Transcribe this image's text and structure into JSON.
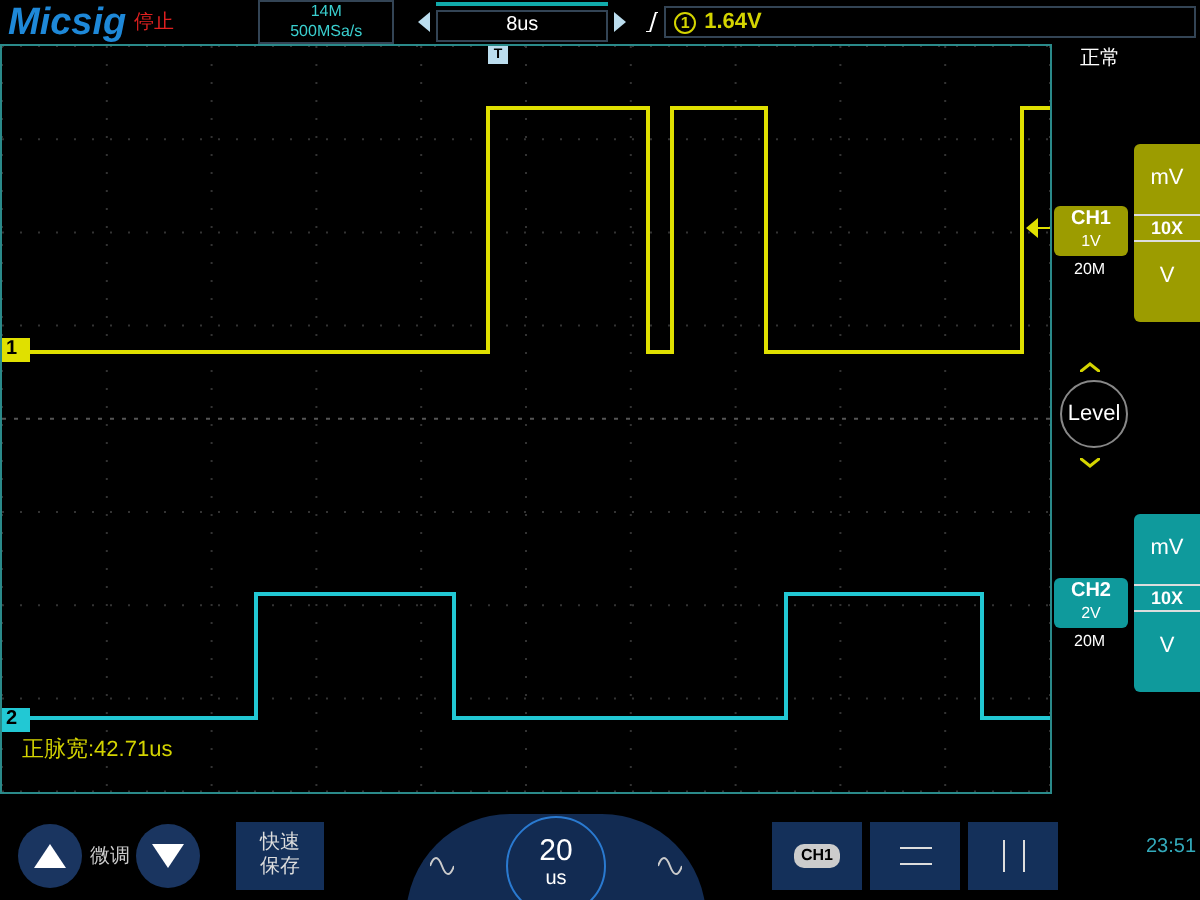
{
  "header": {
    "logo": "Micsig",
    "run_state": "停止",
    "memory_depth": "14M",
    "sample_rate": "500MSa/s",
    "timebase": "8us",
    "trigger_source": "1",
    "trigger_level": "1.64V",
    "trigger_mode": "正常",
    "trigger_marker": "T"
  },
  "channels": [
    {
      "label": "CH1",
      "scale": "1V",
      "bandwidth": "20M",
      "marker": "1",
      "color": "#9c9c00",
      "units": [
        "mV",
        "10X",
        "V"
      ]
    },
    {
      "label": "CH2",
      "scale": "2V",
      "bandwidth": "20M",
      "marker": "2",
      "color": "#0f9a9c",
      "units": [
        "mV",
        "10X",
        "V"
      ]
    }
  ],
  "level_button": "Level",
  "measurement": "正脉宽:42.71us",
  "controls": {
    "fine_tune": "微调",
    "quick_save": "快速保存",
    "time_value": "20",
    "time_unit": "us",
    "channel_button": "CH1"
  },
  "clock": "23:51"
}
